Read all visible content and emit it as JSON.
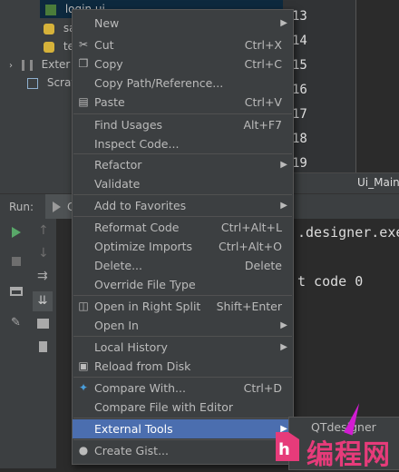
{
  "project_tree": {
    "items": [
      {
        "label": "login.ui",
        "selected": true
      },
      {
        "label": "sa"
      },
      {
        "label": "tes"
      },
      {
        "label": "Exter"
      },
      {
        "label": "Scrat"
      }
    ]
  },
  "editor": {
    "line_numbers": [
      "13",
      "14",
      "15",
      "16",
      "17",
      "18",
      "19"
    ],
    "tab_label": "Ui_Main"
  },
  "run_panel": {
    "title": "Run:",
    "tab_label": "C",
    "console_lines": [
      ".designer.exe",
      "t code 0"
    ]
  },
  "context_menu": {
    "items": [
      {
        "label": "New",
        "submenu": true
      },
      {
        "label": "Cut",
        "shortcut": "Ctrl+X",
        "icon": "scissors-icon"
      },
      {
        "label": "Copy",
        "shortcut": "Ctrl+C",
        "icon": "copy-icon"
      },
      {
        "label": "Copy Path/Reference..."
      },
      {
        "label": "Paste",
        "shortcut": "Ctrl+V",
        "icon": "paste-icon"
      },
      {
        "label": "Find Usages",
        "shortcut": "Alt+F7"
      },
      {
        "label": "Inspect Code..."
      },
      {
        "label": "Refactor",
        "submenu": true
      },
      {
        "label": "Validate"
      },
      {
        "label": "Add to Favorites",
        "submenu": true
      },
      {
        "label": "Reformat Code",
        "shortcut": "Ctrl+Alt+L"
      },
      {
        "label": "Optimize Imports",
        "shortcut": "Ctrl+Alt+O"
      },
      {
        "label": "Delete...",
        "shortcut": "Delete"
      },
      {
        "label": "Override File Type"
      },
      {
        "label": "Open in Right Split",
        "shortcut": "Shift+Enter",
        "icon": "split-icon"
      },
      {
        "label": "Open In",
        "submenu": true
      },
      {
        "label": "Local History",
        "submenu": true
      },
      {
        "label": "Reload from Disk",
        "icon": "reload-icon"
      },
      {
        "label": "Compare With...",
        "shortcut": "Ctrl+D",
        "icon": "compare-icon"
      },
      {
        "label": "Compare File with Editor"
      },
      {
        "label": "External Tools",
        "submenu": true,
        "highlighted": true
      },
      {
        "label": "Create Gist...",
        "icon": "github-icon"
      }
    ]
  },
  "submenu": {
    "item": "QTdesigner"
  },
  "watermark": {
    "text": "编程网"
  },
  "colors": {
    "menu_bg": "#3c3f41",
    "highlight": "#4b6eaf",
    "watermark": "#e63b7a",
    "cursor": "#d21cd2"
  }
}
